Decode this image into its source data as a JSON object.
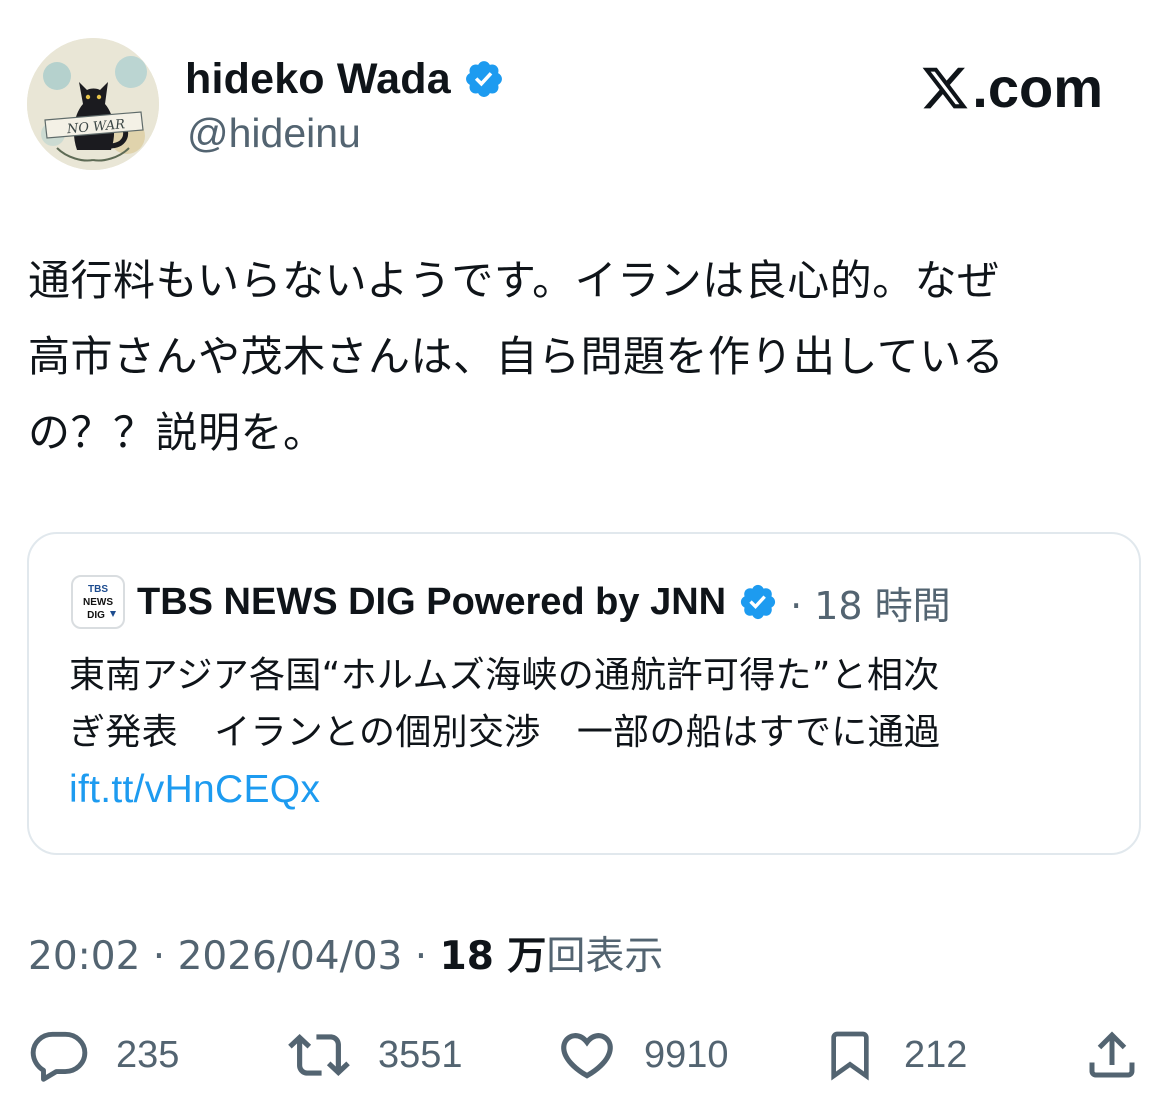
{
  "author": {
    "display_name": "hideko Wada",
    "handle": "@hideinu",
    "avatar_text": "NO WAR"
  },
  "brand": {
    "label": ".com"
  },
  "tweet": {
    "lines": [
      "通行料もいらないようです。イランは良心的。なぜ",
      "高市さんや茂木さんは、自ら問題を作り出している",
      "の？？説明を。"
    ]
  },
  "quote": {
    "logo_lines": [
      "TBS",
      "NEWS",
      "DIG"
    ],
    "name": "TBS NEWS DIG Powered by JNN",
    "time": "· 18 時間",
    "body_lines": [
      "東南アジア各国“ホルムズ海峡の通航許可得た”と相次",
      "ぎ発表　イランとの個別交渉　一部の船はすでに通過"
    ],
    "link": "ift.tt/vHnCEQx"
  },
  "meta": {
    "timestamp": "20:02 · 2026/04/03 · ",
    "views_count": "18 万",
    "views_label": "回表示"
  },
  "actions": {
    "replies": "235",
    "reposts": "3551",
    "likes": "9910",
    "bookmarks": "212"
  },
  "colors": {
    "text": "#0f1419",
    "secondary": "#536471",
    "verified": "#1d9bf0",
    "link": "#1d9bf0",
    "border": "#e1e8ed"
  }
}
